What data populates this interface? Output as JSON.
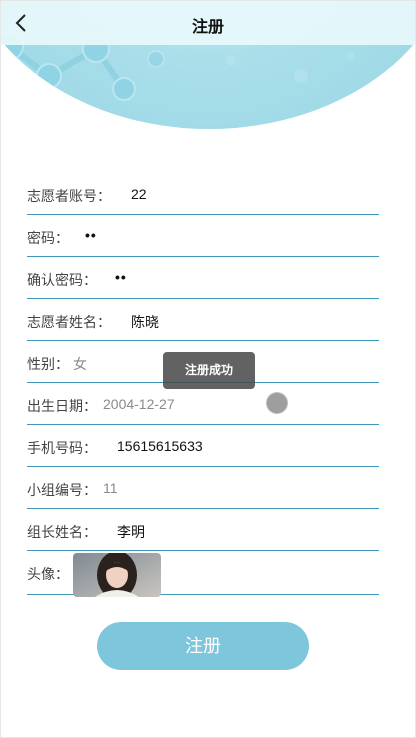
{
  "header": {
    "title": "注册"
  },
  "form": {
    "fields": [
      {
        "label": "志愿者账号：",
        "value": "22"
      },
      {
        "label": "密码：",
        "value": "••"
      },
      {
        "label": "确认密码：",
        "value": "••"
      },
      {
        "label": "志愿者姓名：",
        "value": "陈晓"
      },
      {
        "label": "性别：",
        "value": "女"
      },
      {
        "label": "出生日期：",
        "value": "2004-12-27"
      },
      {
        "label": "手机号码：",
        "value": "15615615633"
      },
      {
        "label": "小组编号：",
        "value": "11"
      },
      {
        "label": "组长姓名：",
        "value": "李明"
      },
      {
        "label": "头像："
      }
    ]
  },
  "toast": {
    "text": "注册成功"
  },
  "submit": {
    "label": "注册"
  },
  "colors": {
    "accent": "#7ec6dc",
    "divider": "#3f97b9",
    "hero": "#a6dde9"
  }
}
